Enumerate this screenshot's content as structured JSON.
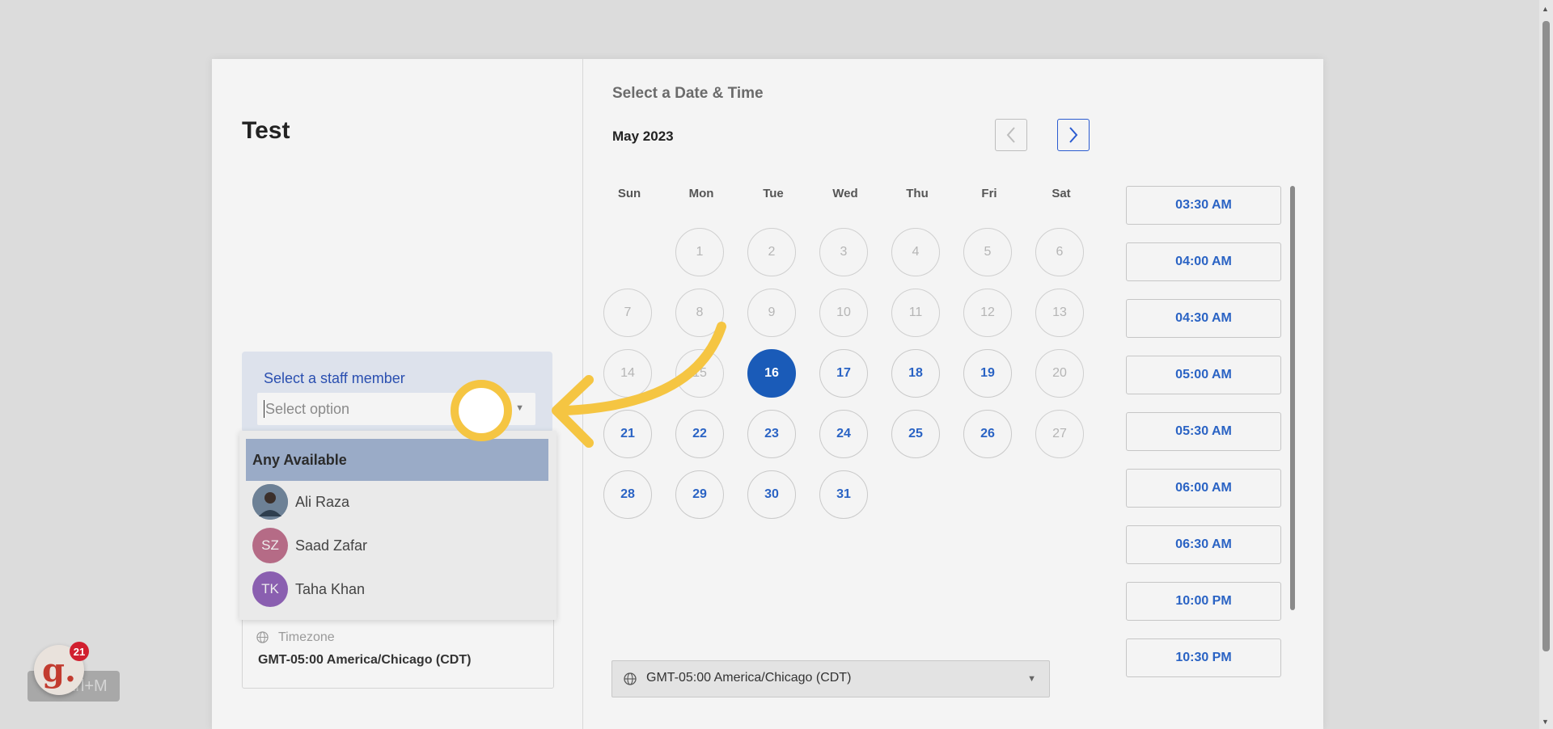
{
  "event": {
    "title": "Test"
  },
  "staff": {
    "label": "Select a staff member",
    "placeholder": "Select option",
    "options": [
      {
        "label": "Any Available",
        "selected": true
      },
      {
        "label": "Ali Raza",
        "initials": ""
      },
      {
        "label": "Saad Zafar",
        "initials": "SZ",
        "color": "#b56b86"
      },
      {
        "label": "Taha Khan",
        "initials": "TK",
        "color": "#8a5fb0"
      }
    ]
  },
  "timezone": {
    "label": "Timezone",
    "value": "GMT-05:00 America/Chicago (CDT)"
  },
  "calendar": {
    "heading": "Select a Date & Time",
    "month": "May 2023",
    "prev_icon": "chevron-left-icon",
    "next_icon": "chevron-right-icon",
    "weekdays": [
      "Sun",
      "Mon",
      "Tue",
      "Wed",
      "Thu",
      "Fri",
      "Sat"
    ],
    "days": [
      [
        "",
        "1",
        "2",
        "3",
        "4",
        "5",
        "6"
      ],
      [
        "7",
        "8",
        "9",
        "10",
        "11",
        "12",
        "13"
      ],
      [
        "14",
        "15",
        "16",
        "17",
        "18",
        "19",
        "20"
      ],
      [
        "21",
        "22",
        "23",
        "24",
        "25",
        "26",
        "27"
      ],
      [
        "28",
        "29",
        "30",
        "31",
        "",
        "",
        ""
      ]
    ],
    "available": [
      "16",
      "17",
      "18",
      "19",
      "21",
      "22",
      "23",
      "24",
      "25",
      "26",
      "28",
      "29",
      "30",
      "31"
    ],
    "selected": "16"
  },
  "time_slots": [
    "03:30 AM",
    "04:00 AM",
    "04:30 AM",
    "05:00 AM",
    "05:30 AM",
    "06:00 AM",
    "06:30 AM",
    "10:00 PM",
    "10:30 PM"
  ],
  "bottom_timezone": {
    "value": "GMT-05:00 America/Chicago (CDT)"
  },
  "widget": {
    "letter": "g.",
    "count": "21",
    "shortcut": "Ctrl+M"
  },
  "colors": {
    "accent": "#2a63c4",
    "highlight_arrow": "#f5c542"
  }
}
